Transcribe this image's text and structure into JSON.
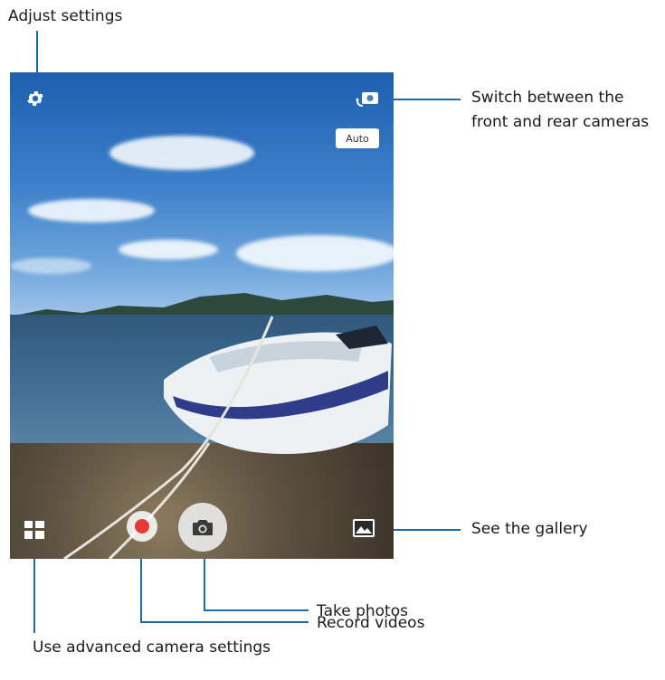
{
  "viewfinder": {
    "scene": "boat on lake shore",
    "auto_label": "Auto",
    "controls": {
      "settings_icon": "gear-icon",
      "switch_icon": "camera-switch-icon",
      "advanced_icon": "grid-modes-icon",
      "record_icon": "record-dot-icon",
      "shutter_icon": "camera-icon",
      "gallery_icon": "image-icon"
    }
  },
  "callouts": {
    "adjust_settings": "Adjust settings",
    "switch_cameras_line1": "Switch between the",
    "switch_cameras_line2": "front and rear cameras",
    "see_gallery": "See the gallery",
    "take_photos": "Take photos",
    "record_videos": "Record videos",
    "advanced_settings": "Use advanced camera settings"
  },
  "colors": {
    "leader_line": "#1b6ca8",
    "record_red": "#e53935"
  }
}
